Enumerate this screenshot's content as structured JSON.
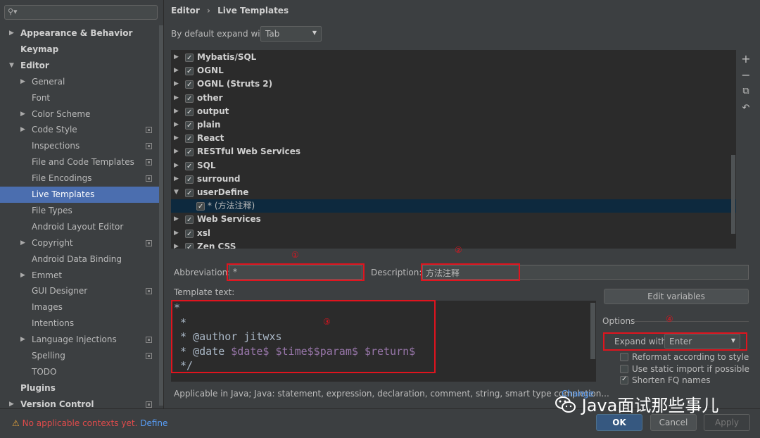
{
  "sidebar": {
    "search_placeholder": "",
    "items": [
      {
        "label": "Appearance & Behavior",
        "arrow": "▶",
        "bold": true,
        "level": 0
      },
      {
        "label": "Keymap",
        "arrow": "",
        "bold": true,
        "level": 0
      },
      {
        "label": "Editor",
        "arrow": "▼",
        "bold": true,
        "level": 0
      },
      {
        "label": "General",
        "arrow": "▶",
        "bold": false,
        "level": 1
      },
      {
        "label": "Font",
        "arrow": "",
        "bold": false,
        "level": 1
      },
      {
        "label": "Color Scheme",
        "arrow": "▶",
        "bold": false,
        "level": 1
      },
      {
        "label": "Code Style",
        "arrow": "▶",
        "bold": false,
        "level": 1,
        "project": true
      },
      {
        "label": "Inspections",
        "arrow": "",
        "bold": false,
        "level": 1,
        "project": true
      },
      {
        "label": "File and Code Templates",
        "arrow": "",
        "bold": false,
        "level": 1,
        "project": true
      },
      {
        "label": "File Encodings",
        "arrow": "",
        "bold": false,
        "level": 1,
        "project": true
      },
      {
        "label": "Live Templates",
        "arrow": "",
        "bold": false,
        "level": 1,
        "selected": true
      },
      {
        "label": "File Types",
        "arrow": "",
        "bold": false,
        "level": 1
      },
      {
        "label": "Android Layout Editor",
        "arrow": "",
        "bold": false,
        "level": 1
      },
      {
        "label": "Copyright",
        "arrow": "▶",
        "bold": false,
        "level": 1,
        "project": true
      },
      {
        "label": "Android Data Binding",
        "arrow": "",
        "bold": false,
        "level": 1
      },
      {
        "label": "Emmet",
        "arrow": "▶",
        "bold": false,
        "level": 1
      },
      {
        "label": "GUI Designer",
        "arrow": "",
        "bold": false,
        "level": 1,
        "project": true
      },
      {
        "label": "Images",
        "arrow": "",
        "bold": false,
        "level": 1
      },
      {
        "label": "Intentions",
        "arrow": "",
        "bold": false,
        "level": 1
      },
      {
        "label": "Language Injections",
        "arrow": "▶",
        "bold": false,
        "level": 1,
        "project": true
      },
      {
        "label": "Spelling",
        "arrow": "",
        "bold": false,
        "level": 1,
        "project": true
      },
      {
        "label": "TODO",
        "arrow": "",
        "bold": false,
        "level": 1
      },
      {
        "label": "Plugins",
        "arrow": "",
        "bold": true,
        "level": 0
      },
      {
        "label": "Version Control",
        "arrow": "▶",
        "bold": true,
        "level": 0,
        "project": true
      }
    ]
  },
  "breadcrumb": {
    "part1": "Editor",
    "sep": "›",
    "part2": "Live Templates"
  },
  "expand_default": {
    "label": "By default expand with",
    "value": "Tab"
  },
  "template_groups": [
    {
      "name": "Mybatis/SQL",
      "checked": true,
      "arrow": "▶"
    },
    {
      "name": "OGNL",
      "checked": true,
      "arrow": "▶"
    },
    {
      "name": "OGNL (Struts 2)",
      "checked": true,
      "arrow": "▶"
    },
    {
      "name": "other",
      "checked": true,
      "arrow": "▶"
    },
    {
      "name": "output",
      "checked": true,
      "arrow": "▶"
    },
    {
      "name": "plain",
      "checked": true,
      "arrow": "▶"
    },
    {
      "name": "React",
      "checked": true,
      "arrow": "▶"
    },
    {
      "name": "RESTful Web Services",
      "checked": true,
      "arrow": "▶"
    },
    {
      "name": "SQL",
      "checked": true,
      "arrow": "▶"
    },
    {
      "name": "surround",
      "checked": true,
      "arrow": "▶"
    },
    {
      "name": "userDefine",
      "checked": true,
      "arrow": "▼"
    },
    {
      "name": "* (方法注释)",
      "checked": true,
      "arrow": "",
      "sub": true
    },
    {
      "name": "Web Services",
      "checked": true,
      "arrow": "▶"
    },
    {
      "name": "xsl",
      "checked": true,
      "arrow": "▶"
    },
    {
      "name": "Zen CSS",
      "checked": true,
      "arrow": "▶"
    }
  ],
  "toolbar": {
    "add": "+",
    "remove": "−",
    "copy": "⧉",
    "revert": "↶"
  },
  "abbreviation": {
    "label": "Abbreviation:",
    "value": "*"
  },
  "description": {
    "label": "Description:",
    "value": "方法注释"
  },
  "template_text": {
    "label": "Template text:",
    "lines": [
      [
        {
          "t": "*"
        }
      ],
      [
        {
          "t": " *"
        }
      ],
      [
        {
          "t": " * @author jitwxs"
        }
      ],
      [
        {
          "t": " * @date "
        },
        {
          "t": "$date$",
          "v": true
        },
        {
          "t": " "
        },
        {
          "t": "$time$$param$",
          "v": true
        },
        {
          "t": " "
        },
        {
          "t": "$return$",
          "v": true
        }
      ],
      [
        {
          "t": " */"
        }
      ]
    ]
  },
  "edit_variables": "Edit variables",
  "options": {
    "title": "Options",
    "expand_label": "Expand with",
    "expand_value": "Enter",
    "checks": [
      {
        "label": "Reformat according to style",
        "checked": false
      },
      {
        "label": "Use static import if possible",
        "checked": false
      },
      {
        "label": "Shorten FQ names",
        "checked": true
      }
    ]
  },
  "applicable": {
    "text": "Applicable in Java; Java: statement, expression, declaration, comment, string, smart type completion...",
    "change": "Change"
  },
  "annotations": {
    "c1": "①",
    "c2": "②",
    "c3": "③",
    "c4": "④"
  },
  "warning": {
    "text": "No applicable contexts yet.",
    "link": "Define"
  },
  "buttons": {
    "ok": "OK",
    "cancel": "Cancel",
    "apply": "Apply"
  },
  "watermark": "Java面试那些事儿",
  "colors": {
    "accent": "#4b6eaf",
    "annotation": "#e0141e",
    "ok": "#365880"
  }
}
